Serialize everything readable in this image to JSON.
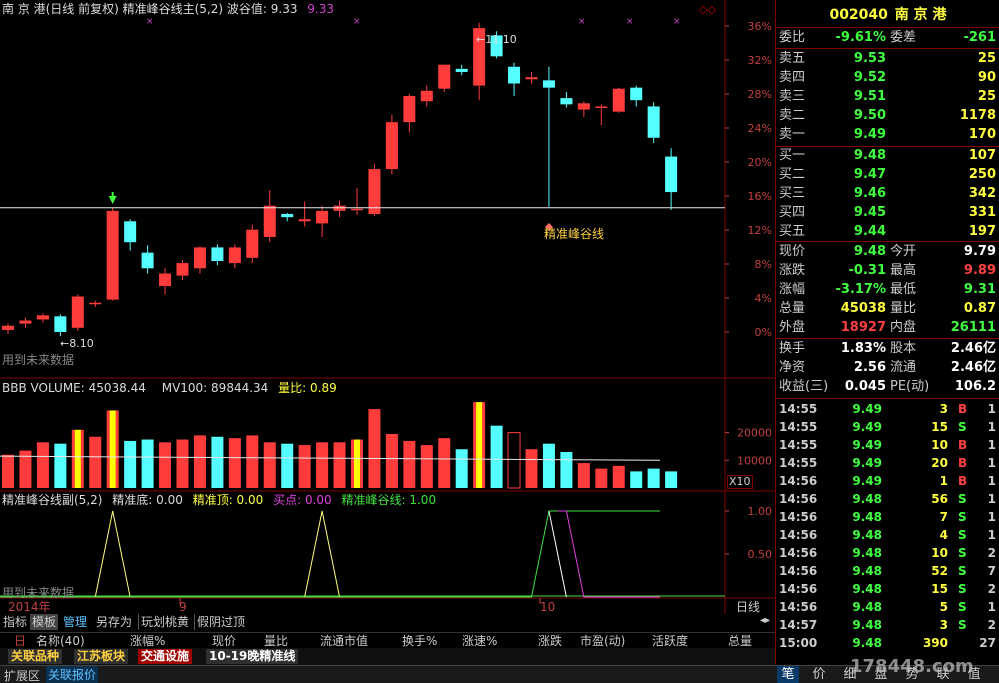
{
  "main_panel": {
    "title": "南 京 港(日线 前复权) 精准峰谷线主(5,2) 波谷值: 9.33",
    "title_extra": "9.33",
    "high_label": "11.10",
    "low_label": "8.10",
    "line_label": "精准峰谷线",
    "future_label": "用到未来数据",
    "y_ticks": [
      "36%",
      "32%",
      "28%",
      "24%",
      "20%",
      "16%",
      "12%",
      "8%",
      "4%",
      "0%"
    ]
  },
  "volume_panel": {
    "title_name": "BBB VOLUME: 45038.44",
    "title_mv": "MV100: 89844.34",
    "title_lb": "量比: 0.89",
    "y_ticks": [
      "20000",
      "10000"
    ],
    "unit": "X10"
  },
  "sub_panel": {
    "title_name": "精准峰谷线副(5,2)",
    "bottom": "精准底: 0.00",
    "top": "精准顶: 0.00",
    "buy": "买点: 0.00",
    "line": "精准峰谷线: 1.00",
    "y_ticks": [
      "1.00",
      "0.50"
    ],
    "future_label": "用到未来数据"
  },
  "x_axis": {
    "labels": [
      "2014年",
      "9",
      "10"
    ],
    "period": "日线"
  },
  "bottom_tabs": [
    "指标",
    "模板",
    "管理",
    "另存为",
    "玩划桃黄",
    "假阴过顶"
  ],
  "columns": [
    "名称(40)",
    "涨幅%",
    "现价",
    "量比",
    "流通市值",
    "换手%",
    "涨速%",
    "涨跌",
    "市盈(动)",
    "活跃度",
    "总量"
  ],
  "column_prefix": "日",
  "block_tabs": [
    "关联品种",
    "江苏板块",
    "交通设施",
    "10-19晚精准线"
  ],
  "status_bar": [
    "扩展区",
    "关联报价"
  ],
  "watermark": "178448.com",
  "right_tabs": [
    "笔",
    "价",
    "细",
    "盘",
    "势",
    "联",
    "值"
  ],
  "quote": {
    "code": "002040",
    "name": "南 京 港",
    "webi": {
      "label": "委比",
      "value": "-9.61%",
      "label2": "委差",
      "value2": "-261"
    },
    "asks": [
      {
        "label": "卖五",
        "price": "9.53",
        "vol": "25"
      },
      {
        "label": "卖四",
        "price": "9.52",
        "vol": "90"
      },
      {
        "label": "卖三",
        "price": "9.51",
        "vol": "25"
      },
      {
        "label": "卖二",
        "price": "9.50",
        "vol": "1178"
      },
      {
        "label": "卖一",
        "price": "9.49",
        "vol": "170"
      }
    ],
    "bids": [
      {
        "label": "买一",
        "price": "9.48",
        "vol": "107"
      },
      {
        "label": "买二",
        "price": "9.47",
        "vol": "250"
      },
      {
        "label": "买三",
        "price": "9.46",
        "vol": "342"
      },
      {
        "label": "买四",
        "price": "9.45",
        "vol": "331"
      },
      {
        "label": "买五",
        "price": "9.44",
        "vol": "197"
      }
    ],
    "stats": [
      {
        "l1": "现价",
        "v1": "9.48",
        "l2": "今开",
        "v2": "9.79"
      },
      {
        "l1": "涨跌",
        "v1": "-0.31",
        "l2": "最高",
        "v2": "9.89"
      },
      {
        "l1": "涨幅",
        "v1": "-3.17%",
        "l2": "最低",
        "v2": "9.31"
      },
      {
        "l1": "总量",
        "v1": "45038",
        "l2": "量比",
        "v2": "0.87"
      },
      {
        "l1": "外盘",
        "v1": "18927",
        "l2": "内盘",
        "v2": "26111"
      }
    ],
    "stats2": [
      {
        "l1": "换手",
        "v1": "1.83%",
        "l2": "股本",
        "v2": "2.46亿"
      },
      {
        "l1": "净资",
        "v1": "2.56",
        "l2": "流通",
        "v2": "2.46亿"
      },
      {
        "l1": "收益(三)",
        "v1": "0.045",
        "l2": "PE(动)",
        "v2": "106.2"
      }
    ]
  },
  "ticks": [
    {
      "time": "14:55",
      "price": "9.49",
      "vol": "3",
      "bs": "B",
      "n": "1"
    },
    {
      "time": "14:55",
      "price": "9.49",
      "vol": "15",
      "bs": "S",
      "n": "1"
    },
    {
      "time": "14:55",
      "price": "9.49",
      "vol": "10",
      "bs": "B",
      "n": "1"
    },
    {
      "time": "14:55",
      "price": "9.49",
      "vol": "20",
      "bs": "B",
      "n": "1"
    },
    {
      "time": "14:56",
      "price": "9.49",
      "vol": "1",
      "bs": "B",
      "n": "1"
    },
    {
      "time": "14:56",
      "price": "9.48",
      "vol": "56",
      "bs": "S",
      "n": "1"
    },
    {
      "time": "14:56",
      "price": "9.48",
      "vol": "7",
      "bs": "S",
      "n": "1"
    },
    {
      "time": "14:56",
      "price": "9.48",
      "vol": "4",
      "bs": "S",
      "n": "1"
    },
    {
      "time": "14:56",
      "price": "9.48",
      "vol": "10",
      "bs": "S",
      "n": "2"
    },
    {
      "time": "14:56",
      "price": "9.48",
      "vol": "52",
      "bs": "S",
      "n": "7"
    },
    {
      "time": "14:56",
      "price": "9.48",
      "vol": "15",
      "bs": "S",
      "n": "2"
    },
    {
      "time": "14:56",
      "price": "9.48",
      "vol": "5",
      "bs": "S",
      "n": "1"
    },
    {
      "time": "14:57",
      "price": "9.48",
      "vol": "3",
      "bs": "S",
      "n": "2"
    },
    {
      "time": "15:00",
      "price": "9.48",
      "vol": "390",
      "bs": "",
      "n": "27"
    }
  ],
  "candles": [
    {
      "o": 8.16,
      "h": 8.22,
      "l": 8.12,
      "c": 8.2
    },
    {
      "o": 8.22,
      "h": 8.28,
      "l": 8.18,
      "c": 8.25
    },
    {
      "o": 8.26,
      "h": 8.32,
      "l": 8.23,
      "c": 8.3
    },
    {
      "o": 8.29,
      "h": 8.31,
      "l": 8.1,
      "c": 8.14
    },
    {
      "o": 8.18,
      "h": 8.5,
      "l": 8.15,
      "c": 8.48
    },
    {
      "o": 8.42,
      "h": 8.44,
      "l": 8.38,
      "c": 8.42
    },
    {
      "o": 8.45,
      "h": 9.33,
      "l": 8.44,
      "c": 9.3
    },
    {
      "o": 9.2,
      "h": 9.22,
      "l": 8.92,
      "c": 9.0
    },
    {
      "o": 8.9,
      "h": 8.97,
      "l": 8.7,
      "c": 8.75
    },
    {
      "o": 8.58,
      "h": 8.75,
      "l": 8.5,
      "c": 8.7
    },
    {
      "o": 8.68,
      "h": 8.83,
      "l": 8.64,
      "c": 8.8
    },
    {
      "o": 8.75,
      "h": 8.96,
      "l": 8.7,
      "c": 8.95
    },
    {
      "o": 8.95,
      "h": 8.98,
      "l": 8.78,
      "c": 8.82
    },
    {
      "o": 8.8,
      "h": 8.98,
      "l": 8.75,
      "c": 8.95
    },
    {
      "o": 8.85,
      "h": 9.17,
      "l": 8.8,
      "c": 9.12
    },
    {
      "o": 9.05,
      "h": 9.5,
      "l": 9.0,
      "c": 9.35
    },
    {
      "o": 9.27,
      "h": 9.28,
      "l": 9.2,
      "c": 9.24
    },
    {
      "o": 9.2,
      "h": 9.39,
      "l": 9.15,
      "c": 9.22
    },
    {
      "o": 9.18,
      "h": 9.35,
      "l": 9.05,
      "c": 9.3
    },
    {
      "o": 9.3,
      "h": 9.4,
      "l": 9.24,
      "c": 9.35
    },
    {
      "o": 9.32,
      "h": 9.52,
      "l": 9.26,
      "c": 9.32
    },
    {
      "o": 9.27,
      "h": 9.75,
      "l": 9.25,
      "c": 9.7
    },
    {
      "o": 9.7,
      "h": 10.22,
      "l": 9.65,
      "c": 10.15
    },
    {
      "o": 10.15,
      "h": 10.42,
      "l": 10.05,
      "c": 10.4
    },
    {
      "o": 10.35,
      "h": 10.5,
      "l": 10.3,
      "c": 10.45
    },
    {
      "o": 10.47,
      "h": 10.58,
      "l": 10.44,
      "c": 10.7
    },
    {
      "o": 10.66,
      "h": 10.7,
      "l": 10.6,
      "c": 10.63
    },
    {
      "o": 10.5,
      "h": 11.1,
      "l": 10.36,
      "c": 11.05
    },
    {
      "o": 10.98,
      "h": 11.02,
      "l": 10.76,
      "c": 10.78
    },
    {
      "o": 10.68,
      "h": 10.72,
      "l": 10.4,
      "c": 10.52
    },
    {
      "o": 10.56,
      "h": 10.63,
      "l": 10.52,
      "c": 10.58
    },
    {
      "o": 10.55,
      "h": 10.68,
      "l": 9.34,
      "c": 10.48
    },
    {
      "o": 10.38,
      "h": 10.44,
      "l": 10.29,
      "c": 10.32
    },
    {
      "o": 10.27,
      "h": 10.35,
      "l": 10.2,
      "c": 10.33
    },
    {
      "o": 10.3,
      "h": 10.32,
      "l": 10.12,
      "c": 10.3
    },
    {
      "o": 10.25,
      "h": 10.48,
      "l": 10.24,
      "c": 10.47
    },
    {
      "o": 10.48,
      "h": 10.5,
      "l": 10.3,
      "c": 10.36
    },
    {
      "o": 10.3,
      "h": 10.34,
      "l": 9.95,
      "c": 10.0
    },
    {
      "o": 9.82,
      "h": 9.9,
      "l": 9.31,
      "c": 9.48
    }
  ],
  "volumes": [
    24,
    27,
    33,
    32,
    42,
    37,
    56,
    34,
    35,
    33,
    35,
    38,
    37,
    36,
    38,
    33,
    32,
    31,
    33,
    33,
    35,
    57,
    39,
    34,
    31,
    36,
    28,
    62,
    45,
    40,
    28,
    32,
    26,
    18,
    14,
    16,
    12,
    14,
    12
  ],
  "volume_highlight": [
    4,
    6,
    20,
    27
  ],
  "line_price": 9.33,
  "base_price": 8.14
}
